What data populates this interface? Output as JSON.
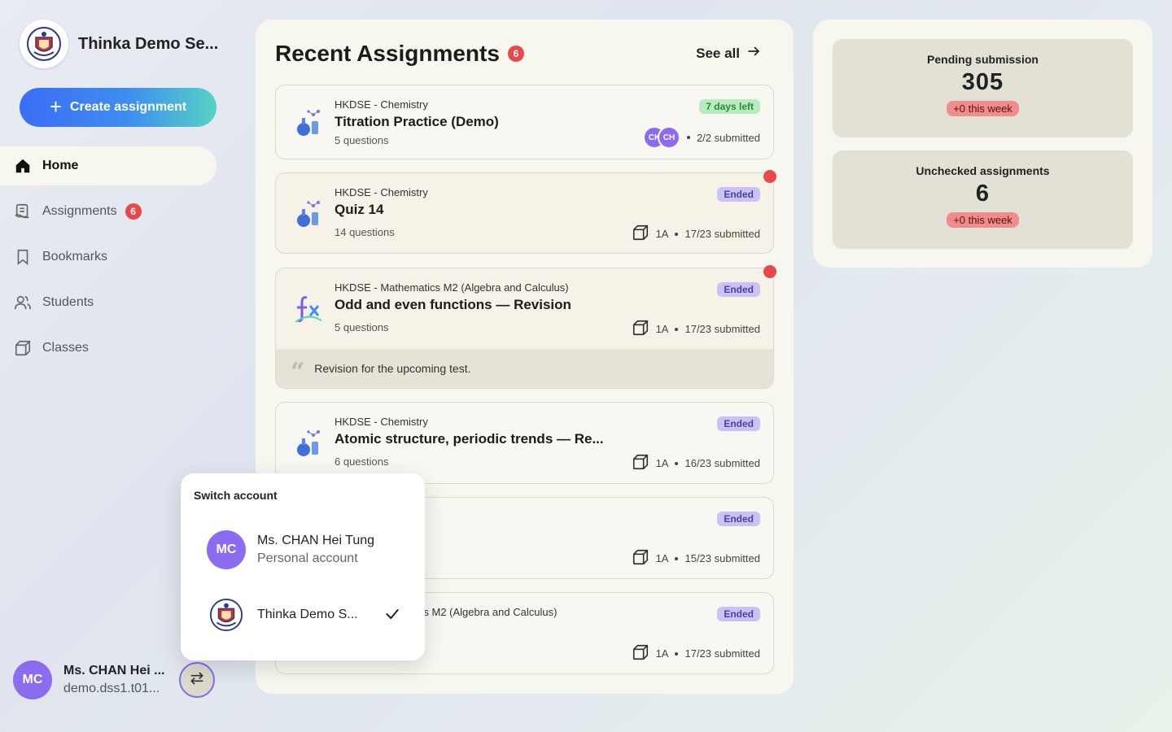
{
  "sidebar": {
    "school_name": "Thinka Demo Se...",
    "create_label": "Create assignment",
    "items": [
      {
        "label": "Home",
        "icon": "home-icon",
        "active": true
      },
      {
        "label": "Assignments",
        "icon": "assignments-icon",
        "badge": "6"
      },
      {
        "label": "Bookmarks",
        "icon": "bookmark-icon"
      },
      {
        "label": "Students",
        "icon": "students-icon"
      },
      {
        "label": "Classes",
        "icon": "classes-icon"
      }
    ],
    "user": {
      "initials": "MC",
      "name": "Ms. CHAN Hei ...",
      "email": "demo.dss1.t01..."
    }
  },
  "main": {
    "title": "Recent Assignments",
    "badge": "6",
    "see_all": "See all",
    "cards": [
      {
        "subject": "HKDSE - Chemistry",
        "title": "Titration Practice (Demo)",
        "questions": "5 questions",
        "status": "7 days left",
        "avatars": [
          "CK",
          "CH"
        ],
        "submitted": "2/2 submitted"
      },
      {
        "subject": "HKDSE - Chemistry",
        "title": "Quiz 14",
        "questions": "14 questions",
        "status": "Ended",
        "class": "1A",
        "submitted": "17/23 submitted"
      },
      {
        "subject": "HKDSE - Mathematics M2 (Algebra and Calculus)",
        "title": "Odd and even functions — Revision",
        "questions": "5 questions",
        "status": "Ended",
        "class": "1A",
        "submitted": "17/23 submitted",
        "note": "Revision for the upcoming test."
      },
      {
        "subject": "HKDSE - Chemistry",
        "title": "Atomic structure, periodic trends — Re...",
        "questions": "6 questions",
        "status": "Ended",
        "class": "1A",
        "submitted": "16/23 submitted"
      },
      {
        "status": "Ended",
        "class": "1A",
        "submitted": "15/23 submitted"
      },
      {
        "subject_partial": "ics M2 (Algebra and Calculus)",
        "status": "Ended",
        "class": "1A",
        "submitted": "17/23 submitted"
      }
    ]
  },
  "stats": [
    {
      "label": "Pending submission",
      "value": "305",
      "change": "+0 this week"
    },
    {
      "label": "Unchecked assignments",
      "value": "6",
      "change": "+0 this week"
    }
  ],
  "switch_account": {
    "title": "Switch account",
    "personal": {
      "initials": "MC",
      "name": "Ms. CHAN Hei Tung",
      "sub": "Personal account"
    },
    "school": {
      "name": "Thinka Demo S..."
    }
  },
  "colors": {
    "accent": "#8b6cf0",
    "badge": "#e8484a",
    "panel": "#f7f6ef"
  }
}
